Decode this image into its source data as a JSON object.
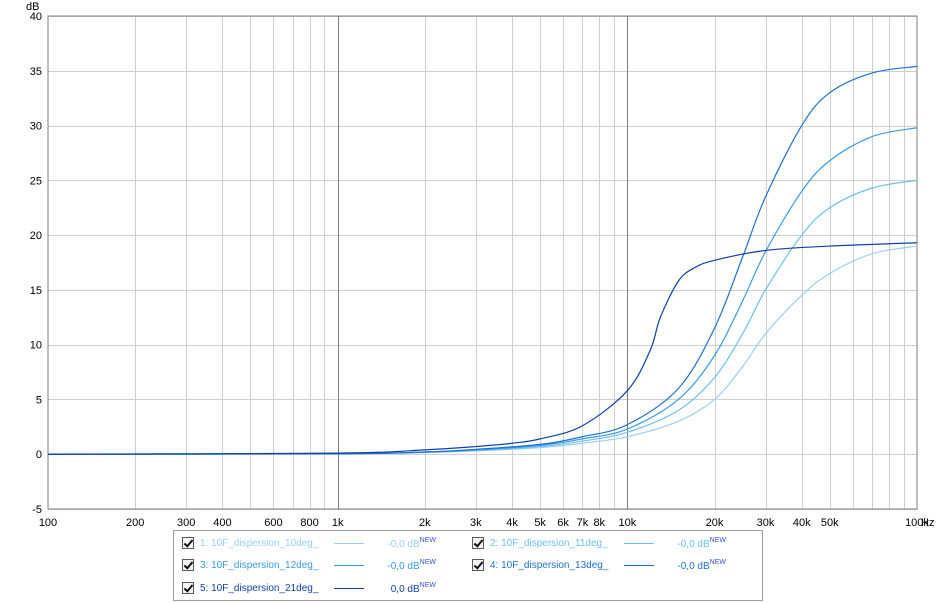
{
  "chart_data": {
    "type": "line",
    "xscale": "log",
    "xlim": [
      100,
      100000
    ],
    "ylim": [
      -5,
      40
    ],
    "ylabel": "dB",
    "xunit": "Hz",
    "grid": true,
    "x_ticks": [
      100,
      200,
      300,
      400,
      600,
      800,
      1000,
      2000,
      3000,
      4000,
      5000,
      6000,
      7000,
      8000,
      10000,
      20000,
      30000,
      40000,
      50000,
      100000
    ],
    "x_tick_labels": [
      "100",
      "200",
      "300",
      "400",
      "600",
      "800",
      "1k",
      "2k",
      "3k",
      "4k",
      "5k",
      "6k",
      "7k",
      "8k",
      "10k",
      "20k",
      "30k",
      "40k",
      "50k",
      "100k"
    ],
    "y_ticks": [
      -5,
      0,
      5,
      10,
      15,
      20,
      25,
      30,
      35,
      40
    ],
    "y_tick_labels": [
      "-5",
      "0",
      "5",
      "10",
      "15",
      "20",
      "25",
      "30",
      "35",
      "40"
    ],
    "series": [
      {
        "name": "1: 10F_dispersion_10deg_",
        "color": "#9ad0f0",
        "x": [
          100,
          1000,
          2000,
          3000,
          5000,
          7000,
          10000,
          15000,
          20000,
          25000,
          30000,
          40000,
          50000,
          70000,
          100000
        ],
        "y": [
          0,
          0.05,
          0.15,
          0.3,
          0.6,
          1.0,
          1.6,
          3.0,
          5.0,
          8.0,
          11.0,
          14.5,
          16.5,
          18.3,
          19.0
        ]
      },
      {
        "name": "2: 10F_dispersion_11deg_",
        "color": "#6ec0ee",
        "x": [
          100,
          1000,
          2000,
          3000,
          5000,
          7000,
          10000,
          15000,
          20000,
          25000,
          30000,
          40000,
          50000,
          70000,
          100000
        ],
        "y": [
          0,
          0.05,
          0.18,
          0.35,
          0.7,
          1.2,
          2.0,
          4.0,
          7.0,
          11.0,
          15.0,
          20.0,
          22.5,
          24.3,
          25.0
        ]
      },
      {
        "name": "3: 10F_dispersion_12deg_",
        "color": "#3a9ae6",
        "x": [
          100,
          1000,
          2000,
          3000,
          5000,
          7000,
          10000,
          15000,
          20000,
          25000,
          30000,
          40000,
          50000,
          70000,
          100000
        ],
        "y": [
          0,
          0.05,
          0.2,
          0.4,
          0.8,
          1.4,
          2.3,
          5.0,
          9.0,
          14.0,
          18.5,
          24.0,
          26.8,
          29.0,
          29.8
        ]
      },
      {
        "name": "4: 10F_dispersion_13deg_",
        "color": "#1f6fd2",
        "x": [
          100,
          1000,
          2000,
          3000,
          5000,
          7000,
          10000,
          15000,
          20000,
          25000,
          30000,
          40000,
          50000,
          70000,
          100000
        ],
        "y": [
          0,
          0.05,
          0.2,
          0.45,
          0.9,
          1.6,
          2.7,
          6.0,
          11.5,
          18.0,
          23.5,
          30.0,
          33.0,
          34.8,
          35.4
        ]
      },
      {
        "name": "5: 10F_dispersion_21deg_",
        "color": "#1240a8",
        "x": [
          100,
          1000,
          2000,
          3000,
          4000,
          5000,
          7000,
          10000,
          12000,
          13000,
          15000,
          17000,
          20000,
          30000,
          50000,
          100000
        ],
        "y": [
          0,
          0.1,
          0.4,
          0.7,
          1.0,
          1.4,
          2.6,
          5.8,
          9.5,
          12.5,
          15.8,
          17.0,
          17.7,
          18.6,
          19.0,
          19.3
        ]
      }
    ]
  },
  "legend": {
    "items": [
      {
        "label": "1: 10F_dispersion_10deg_",
        "value": "-0,0 dB",
        "badge": "NEW",
        "color": "#9ad0f0"
      },
      {
        "label": "2: 10F_dispersion_11deg_",
        "value": "-0,0 dB",
        "badge": "NEW",
        "color": "#6ec0ee"
      },
      {
        "label": "3: 10F_dispersion_12deg_",
        "value": "-0,0 dB",
        "badge": "NEW",
        "color": "#3a9ae6"
      },
      {
        "label": "4: 10F_dispersion_13deg_",
        "value": "-0,0 dB",
        "badge": "NEW",
        "color": "#1f6fd2"
      },
      {
        "label": "5: 10F_dispersion_21deg_",
        "value": "0,0 dB",
        "badge": "NEW",
        "color": "#1240a8"
      }
    ]
  }
}
